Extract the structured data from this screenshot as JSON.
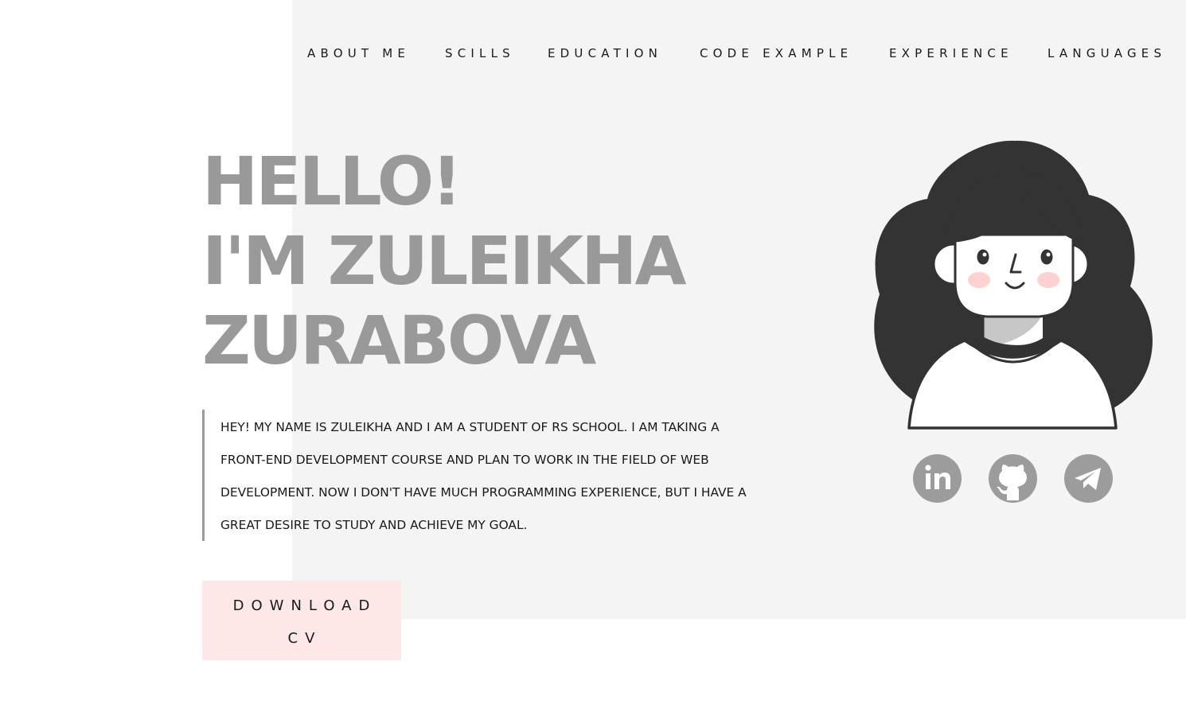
{
  "nav": {
    "items": [
      {
        "label": "ABOUT ME"
      },
      {
        "label": "SCILLS"
      },
      {
        "label": "EDUCATION"
      },
      {
        "label": "CODE EXAMPLE"
      },
      {
        "label": "EXPERIENCE"
      },
      {
        "label": "LANGUAGES"
      }
    ]
  },
  "hero": {
    "line1": "HELLO!",
    "line2": "I'M ZULEIKHA",
    "line3": "ZURABOVA",
    "intro_lines": [
      "HEY! MY NAME IS ZULEIKHA AND I AM A STUDENT OF RS SCHOOL. I AM TAKING A",
      "FRONT-END DEVELOPMENT COURSE AND PLAN TO WORK IN THE FIELD OF WEB",
      "DEVELOPMENT. NOW I DON'T HAVE MUCH PROGRAMMING EXPERIENCE, BUT I HAVE A",
      "GREAT DESIRE TO STUDY AND ACHIEVE MY GOAL."
    ]
  },
  "download": {
    "line1": "DOWNLOAD",
    "line2": "CV"
  },
  "social": {
    "icons": [
      "linkedin-icon",
      "github-icon",
      "telegram-icon"
    ]
  },
  "colors": {
    "panel_bg": "#f4f4f4",
    "title_gray": "#999999",
    "button_pink": "#fde7e7",
    "icon_gray": "#9c9c9c",
    "text_dark": "#1a1a1a",
    "hair": "#333333",
    "blush": "#ffc9c9"
  }
}
